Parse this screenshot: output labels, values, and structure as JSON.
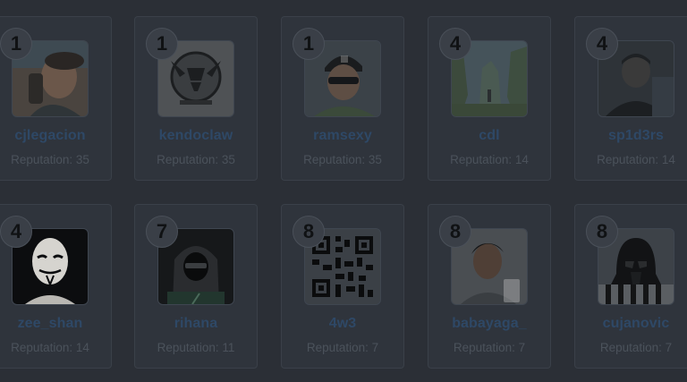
{
  "users": [
    {
      "rank": "1",
      "name": "cjlegacion",
      "reputation": "Reputation: 35",
      "avatar": "photo-man-phone"
    },
    {
      "rank": "1",
      "name": "kendoclaw",
      "reputation": "Reputation: 35",
      "avatar": "emblem-skull-horns"
    },
    {
      "rank": "1",
      "name": "ramsexy",
      "reputation": "Reputation: 35",
      "avatar": "photo-man-cap"
    },
    {
      "rank": "4",
      "name": "cdl",
      "reputation": "Reputation: 14",
      "avatar": "photo-landscape"
    },
    {
      "rank": "4",
      "name": "sp1d3rs",
      "reputation": "Reputation: 14",
      "avatar": "photo-dark-portrait"
    },
    {
      "rank": "4",
      "name": "zee_shan",
      "reputation": "Reputation: 14",
      "avatar": "anonymous-mask"
    },
    {
      "rank": "7",
      "name": "rihana",
      "reputation": "Reputation: 11",
      "avatar": "hooded-hacker"
    },
    {
      "rank": "8",
      "name": "4w3",
      "reputation": "Reputation: 7",
      "avatar": "qr-code"
    },
    {
      "rank": "8",
      "name": "babayaga_",
      "reputation": "Reputation: 7",
      "avatar": "photo-selfie"
    },
    {
      "rank": "8",
      "name": "cujanovic",
      "reputation": "Reputation: 7",
      "avatar": "darth-vader"
    }
  ],
  "colors": {
    "overlay_background": "#2b2f36",
    "username": "#2e4866",
    "reputation_text": "#4b525b",
    "rank_text": "#101214"
  }
}
